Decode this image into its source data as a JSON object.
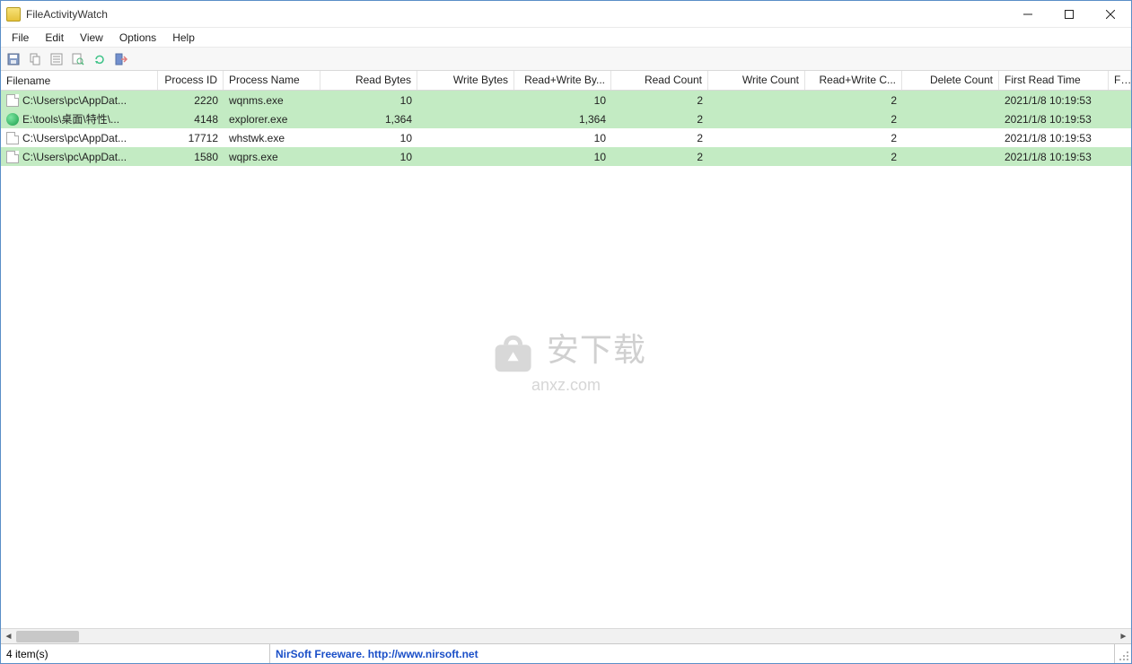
{
  "window": {
    "title": "FileActivityWatch"
  },
  "menu": {
    "file": "File",
    "edit": "Edit",
    "view": "View",
    "options": "Options",
    "help": "Help"
  },
  "toolbar_icons": {
    "save": "save-icon",
    "copy": "copy-icon",
    "properties": "properties-icon",
    "find": "find-icon",
    "refresh": "refresh-icon",
    "exit": "exit-icon"
  },
  "columns": {
    "c0": "Filename",
    "c1": "Process ID",
    "c2": "Process Name",
    "c3": "Read Bytes",
    "c4": "Write Bytes",
    "c5": "Read+Write By...",
    "c6": "Read Count",
    "c7": "Write Count",
    "c8": "Read+Write C...",
    "c9": "Delete Count",
    "c10": "First Read Time",
    "c11": "Fi..."
  },
  "rows": [
    {
      "selected": true,
      "icon": "file",
      "filename": "C:\\Users\\pc\\AppDat...",
      "pid": "2220",
      "pname": "wqnms.exe",
      "readBytes": "10",
      "writeBytes": "",
      "rwBytes": "10",
      "readCount": "2",
      "writeCount": "",
      "rwCount": "2",
      "deleteCount": "",
      "firstRead": "2021/1/8 10:19:53"
    },
    {
      "selected": true,
      "icon": "world",
      "filename": "E:\\tools\\桌面\\特性\\...",
      "pid": "4148",
      "pname": "explorer.exe",
      "readBytes": "1,364",
      "writeBytes": "",
      "rwBytes": "1,364",
      "readCount": "2",
      "writeCount": "",
      "rwCount": "2",
      "deleteCount": "",
      "firstRead": "2021/1/8 10:19:53"
    },
    {
      "selected": false,
      "icon": "file",
      "filename": "C:\\Users\\pc\\AppDat...",
      "pid": "17712",
      "pname": "whstwk.exe",
      "readBytes": "10",
      "writeBytes": "",
      "rwBytes": "10",
      "readCount": "2",
      "writeCount": "",
      "rwCount": "2",
      "deleteCount": "",
      "firstRead": "2021/1/8 10:19:53"
    },
    {
      "selected": true,
      "icon": "file",
      "filename": "C:\\Users\\pc\\AppDat...",
      "pid": "1580",
      "pname": "wqprs.exe",
      "readBytes": "10",
      "writeBytes": "",
      "rwBytes": "10",
      "readCount": "2",
      "writeCount": "",
      "rwCount": "2",
      "deleteCount": "",
      "firstRead": "2021/1/8 10:19:53"
    }
  ],
  "status": {
    "count": "4 item(s)",
    "credit": "NirSoft Freeware.  http://www.nirsoft.net"
  },
  "watermark": {
    "brand": "安下载",
    "sub": "anxz.com"
  }
}
